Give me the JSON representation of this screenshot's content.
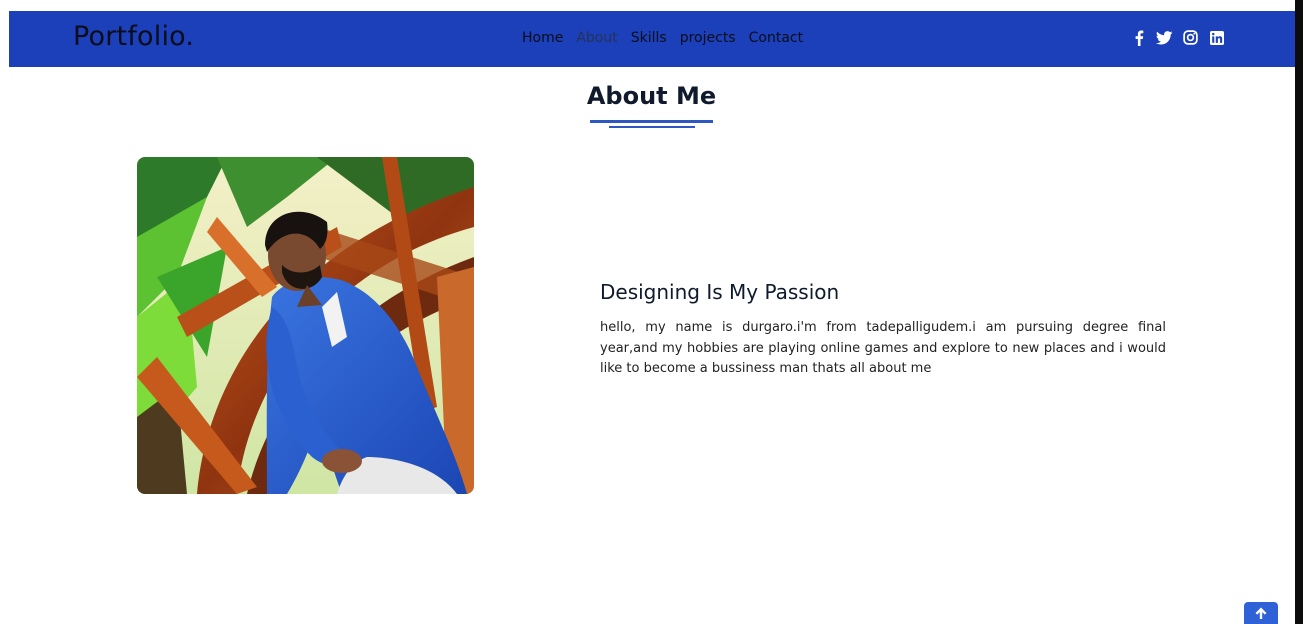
{
  "navbar": {
    "brand": "Portfolio.",
    "menu": [
      {
        "label": "Home"
      },
      {
        "label": "About"
      },
      {
        "label": "Skills"
      },
      {
        "label": "projects"
      },
      {
        "label": "Contact"
      }
    ],
    "active_item": "About",
    "social_icons": [
      "facebook-icon",
      "twitter-icon",
      "instagram-icon",
      "linkedin-icon"
    ]
  },
  "about": {
    "title": "About Me",
    "heading": "Designing Is My Passion",
    "paragraph": "hello, my name is durgaro.i'm from tadepalligudem.i am pursuing degree final year,and my hobbies are playing online games and explore to new places and i would like to become a bussiness man thats all about me"
  },
  "scroll_top_icon": "arrow-up-icon",
  "colors": {
    "navbar_bg": "#1b40b9",
    "accent": "#2f57c1",
    "text_dark": "#0f1a2c",
    "scroll_button": "#2f62d6"
  }
}
